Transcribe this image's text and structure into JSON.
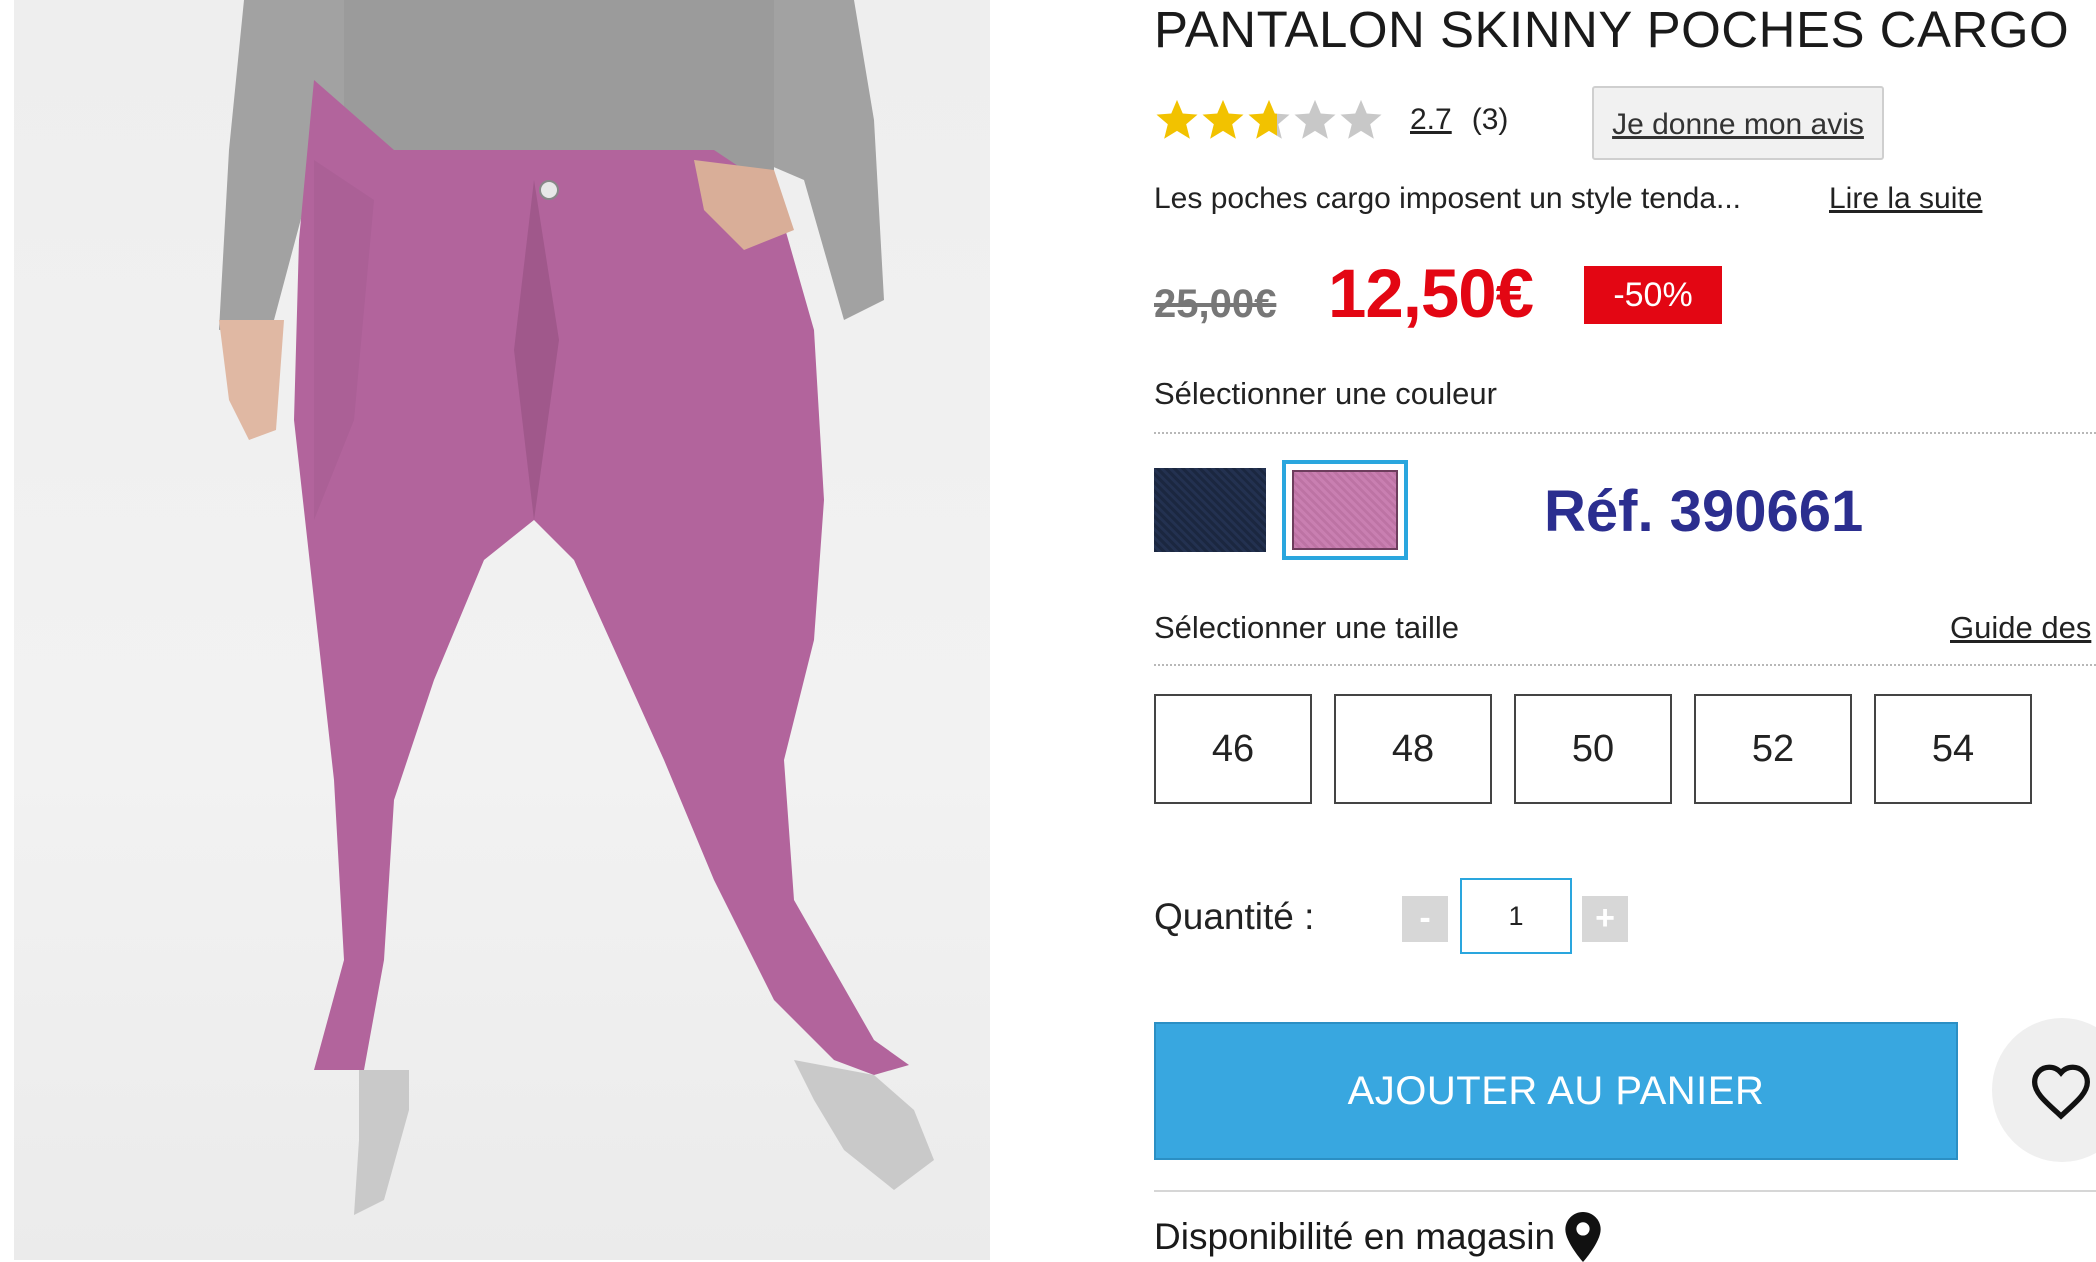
{
  "product": {
    "title": "PANTALON SKINNY POCHES CARGO",
    "rating_value": "2.7",
    "rating_fraction": 0.54,
    "rating_count": "(3)",
    "review_button": "Je donne mon avis",
    "description": "Les poches cargo imposent un style tenda...",
    "read_more": "Lire la suite",
    "old_price": "25,00€",
    "new_price": "12,50€",
    "discount": "-50%",
    "reference": "Réf. 390661"
  },
  "color": {
    "label": "Sélectionner une couleur",
    "options": [
      {
        "name": "navy",
        "hex": "#1d2a44",
        "selected": false
      },
      {
        "name": "pink",
        "hex": "#c67cae",
        "selected": true
      }
    ]
  },
  "size": {
    "label": "Sélectionner une taille",
    "guide_link": "Guide des",
    "options": [
      "46",
      "48",
      "50",
      "52",
      "54"
    ]
  },
  "quantity": {
    "label": "Quantité :",
    "value": "1",
    "minus": "-",
    "plus": "+"
  },
  "actions": {
    "add_to_cart": "AJOUTER AU PANIER",
    "wishlist_icon": "heart-icon"
  },
  "availability": {
    "label": "Disponibilité en magasin",
    "icon": "map-pin-icon"
  },
  "colors": {
    "price_red": "#e30613",
    "accent_blue": "#38a7e0",
    "selected_border": "#2aa6de",
    "star_gold": "#f2c200",
    "ref_blue": "#2b2e8f"
  }
}
